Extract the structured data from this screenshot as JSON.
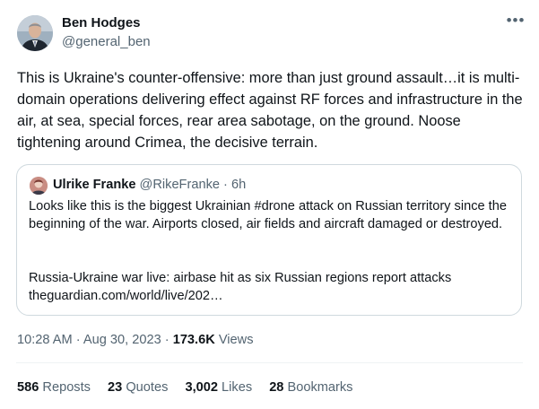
{
  "author": {
    "name": "Ben Hodges",
    "handle": "@general_ben"
  },
  "more_icon": "more-horizontal-icon",
  "tweet_text": "This is Ukraine's counter-offensive: more than just ground assault…it is multi-domain operations delivering effect against RF forces and infrastructure in the air, at sea, special forces, rear area sabotage, on the ground. Noose tightening around Crimea, the decisive terrain.",
  "quote": {
    "name": "Ulrike Franke",
    "handle": "@RikeFranke",
    "separator": "·",
    "time": "6h",
    "text": "Looks like this is the biggest Ukrainian #drone attack on Russian territory since the beginning of the war. Airports closed, air fields and aircraft damaged or destroyed.",
    "link_title": "Russia-Ukraine war live: airbase hit as six Russian regions report attacks",
    "link_url": "theguardian.com/world/live/202…"
  },
  "meta": {
    "time": "10:28 AM",
    "separator": "·",
    "date": "Aug 30, 2023",
    "views_count": "173.6K",
    "views_label": "Views"
  },
  "stats": {
    "reposts_count": "586",
    "reposts_label": "Reposts",
    "quotes_count": "23",
    "quotes_label": "Quotes",
    "likes_count": "3,002",
    "likes_label": "Likes",
    "bookmarks_count": "28",
    "bookmarks_label": "Bookmarks"
  },
  "colors": {
    "text_primary": "#0f1419",
    "text_secondary": "#536471",
    "border": "#cfd9de",
    "divider": "#eff3f4"
  }
}
